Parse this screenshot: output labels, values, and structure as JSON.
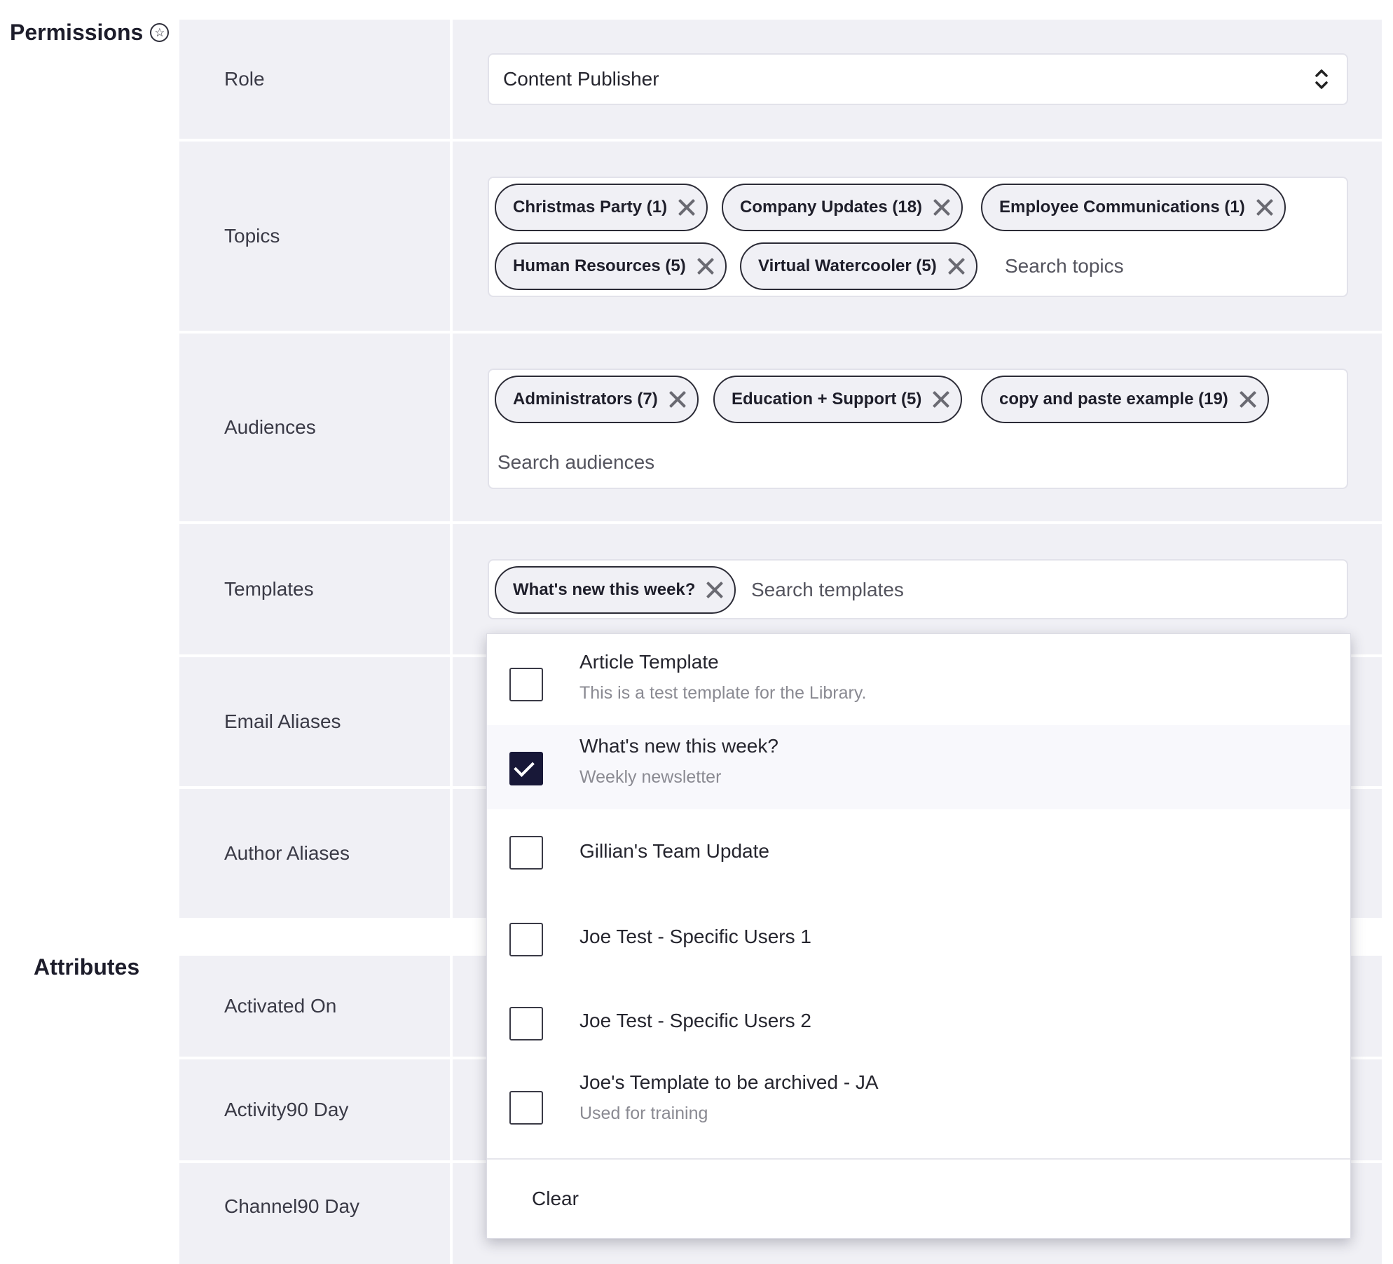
{
  "sections": {
    "permissions_title": "Permissions",
    "attributes_title": "Attributes"
  },
  "fields": {
    "role": {
      "label": "Role",
      "value": "Content Publisher"
    },
    "topics": {
      "label": "Topics",
      "chips": [
        "Christmas Party (1)",
        "Company Updates (18)",
        "Employee Communications (1)",
        "Human Resources (5)",
        "Virtual Watercooler (5)"
      ],
      "placeholder": "Search topics"
    },
    "audiences": {
      "label": "Audiences",
      "chips": [
        "Administrators (7)",
        "Education + Support (5)",
        "copy and paste example (19)"
      ],
      "placeholder": "Search audiences"
    },
    "templates": {
      "label": "Templates",
      "chips": [
        "What's new this week?"
      ],
      "placeholder": "Search templates"
    },
    "email_aliases": {
      "label": "Email Aliases"
    },
    "author_aliases": {
      "label": "Author Aliases"
    },
    "activated_on": {
      "label": "Activated On"
    },
    "activity90": {
      "label": "Activity90 Day"
    },
    "channel90": {
      "label": "Channel90 Day"
    }
  },
  "dropdown": {
    "options": [
      {
        "title": "Article Template",
        "description": "This is a test template for the Library.",
        "checked": false
      },
      {
        "title": "What's new this week?",
        "description": "Weekly newsletter",
        "checked": true
      },
      {
        "title": "Gillian's Team Update",
        "description": "",
        "checked": false
      },
      {
        "title": "Joe Test - Specific Users 1",
        "description": "",
        "checked": false
      },
      {
        "title": "Joe Test - Specific Users 2",
        "description": "",
        "checked": false
      },
      {
        "title": "Joe's Template to be archived - JA",
        "description": "Used for training",
        "checked": false
      }
    ],
    "clear_label": "Clear"
  },
  "icons": {
    "permissions_help": "star-circle-icon",
    "role_select": "up-down-chevron-icon",
    "chip_remove": "close-icon",
    "option_check": "checkmark-icon"
  },
  "colors": {
    "row_background": "#f0f0f5",
    "chip_border": "#2b2b36",
    "checkbox_checked": "#181838"
  }
}
